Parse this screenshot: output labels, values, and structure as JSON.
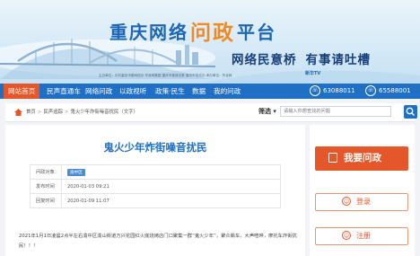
{
  "banner": {
    "title_part1": "重庆网络",
    "title_highlight": "问政",
    "title_part2": "平台",
    "slogan_1": "网络民意桥",
    "slogan_2": "有事请吐槽",
    "sponsors": "主办单位：中共重庆市委网信办  华龙网集团  重庆市委政法委  重庆市信访办  承办单位：华龙网",
    "partner_logo": "新华TV"
  },
  "nav": {
    "items": [
      "网站首页",
      "民声直通车",
      "网络问政",
      "以政视听",
      "政策·民生",
      "数据",
      "我的问政"
    ],
    "hotlines": [
      "63088011",
      "65588001"
    ]
  },
  "breadcrumb": {
    "items": [
      "首页",
      "民声追踪",
      "鬼火少年炸街噪音扰民（文字）"
    ]
  },
  "search": {
    "filter_label": "筛选",
    "placeholder": "请输入你想查找的问题"
  },
  "post": {
    "title": "鬼火少年炸街噪音扰民",
    "target_label": "问政对象：",
    "target_value": "渝中区",
    "posted_label": "发布时间",
    "posted_value": "2020-01-03 09:21",
    "reply_label": "回复时间",
    "reply_value": "2020-01-09 11:07",
    "body": "2021年1月1日凌晨2点半左右渝中区渝山街道万兴花园红火底烧烤店门口聚集一群“鬼火少年”，聚众飙车，大声喧哗，摩托车炸街扰民！！！"
  },
  "sidebar": {
    "ask_label": "我要问政",
    "login_label": "登录",
    "register_label": "注册"
  },
  "colors": {
    "brand_blue": "#1f6fc5",
    "accent_orange": "#e4572a",
    "title_orange": "#f08a24"
  }
}
